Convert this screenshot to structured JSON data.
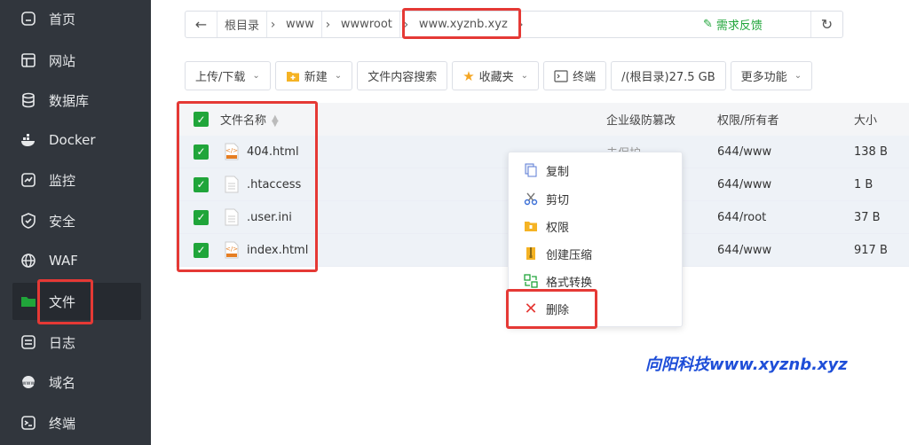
{
  "sidebar": {
    "items": [
      {
        "label": "首页",
        "icon": "home-icon"
      },
      {
        "label": "网站",
        "icon": "website-icon"
      },
      {
        "label": "数据库",
        "icon": "database-icon"
      },
      {
        "label": "Docker",
        "icon": "docker-icon"
      },
      {
        "label": "监控",
        "icon": "monitor-icon"
      },
      {
        "label": "安全",
        "icon": "shield-icon"
      },
      {
        "label": "WAF",
        "icon": "waf-icon"
      },
      {
        "label": "文件",
        "icon": "folder-icon",
        "active": true
      },
      {
        "label": "日志",
        "icon": "log-icon"
      },
      {
        "label": "域名",
        "icon": "domain-icon"
      },
      {
        "label": "终端",
        "icon": "terminal-icon"
      }
    ]
  },
  "breadcrumb": {
    "items": [
      "根目录",
      "www",
      "wwwroot",
      "www.xyznb.xyz"
    ],
    "feedback": "需求反馈"
  },
  "toolbar": {
    "upload": "上传/下载",
    "new": "新建",
    "search": "文件内容搜索",
    "favorites": "收藏夹",
    "terminal": "终端",
    "disk": "/(根目录)27.5 GB",
    "more": "更多功能"
  },
  "table": {
    "headers": {
      "name": "文件名称",
      "protection": "企业级防篡改",
      "permission": "权限/所有者",
      "size": "大小"
    },
    "rows": [
      {
        "name": "404.html",
        "protection": "未保护",
        "permission": "644/www",
        "size": "138 B",
        "type": "html"
      },
      {
        "name": ".htaccess",
        "protection": "",
        "permission": "644/www",
        "size": "1 B",
        "type": "file"
      },
      {
        "name": ".user.ini",
        "protection": "",
        "permission": "644/root",
        "size": "37 B",
        "type": "file"
      },
      {
        "name": "index.html",
        "protection": "",
        "permission": "644/www",
        "size": "917 B",
        "type": "html"
      }
    ]
  },
  "context_menu": {
    "items": [
      "复制",
      "剪切",
      "权限",
      "创建压缩",
      "格式转换",
      "删除"
    ]
  },
  "watermark": "向阳科技www.xyznb.xyz",
  "colors": {
    "sidebar": "#31363d",
    "accent": "#20a53a",
    "highlight": "#e53935",
    "watermark": "#1e4ed8"
  }
}
